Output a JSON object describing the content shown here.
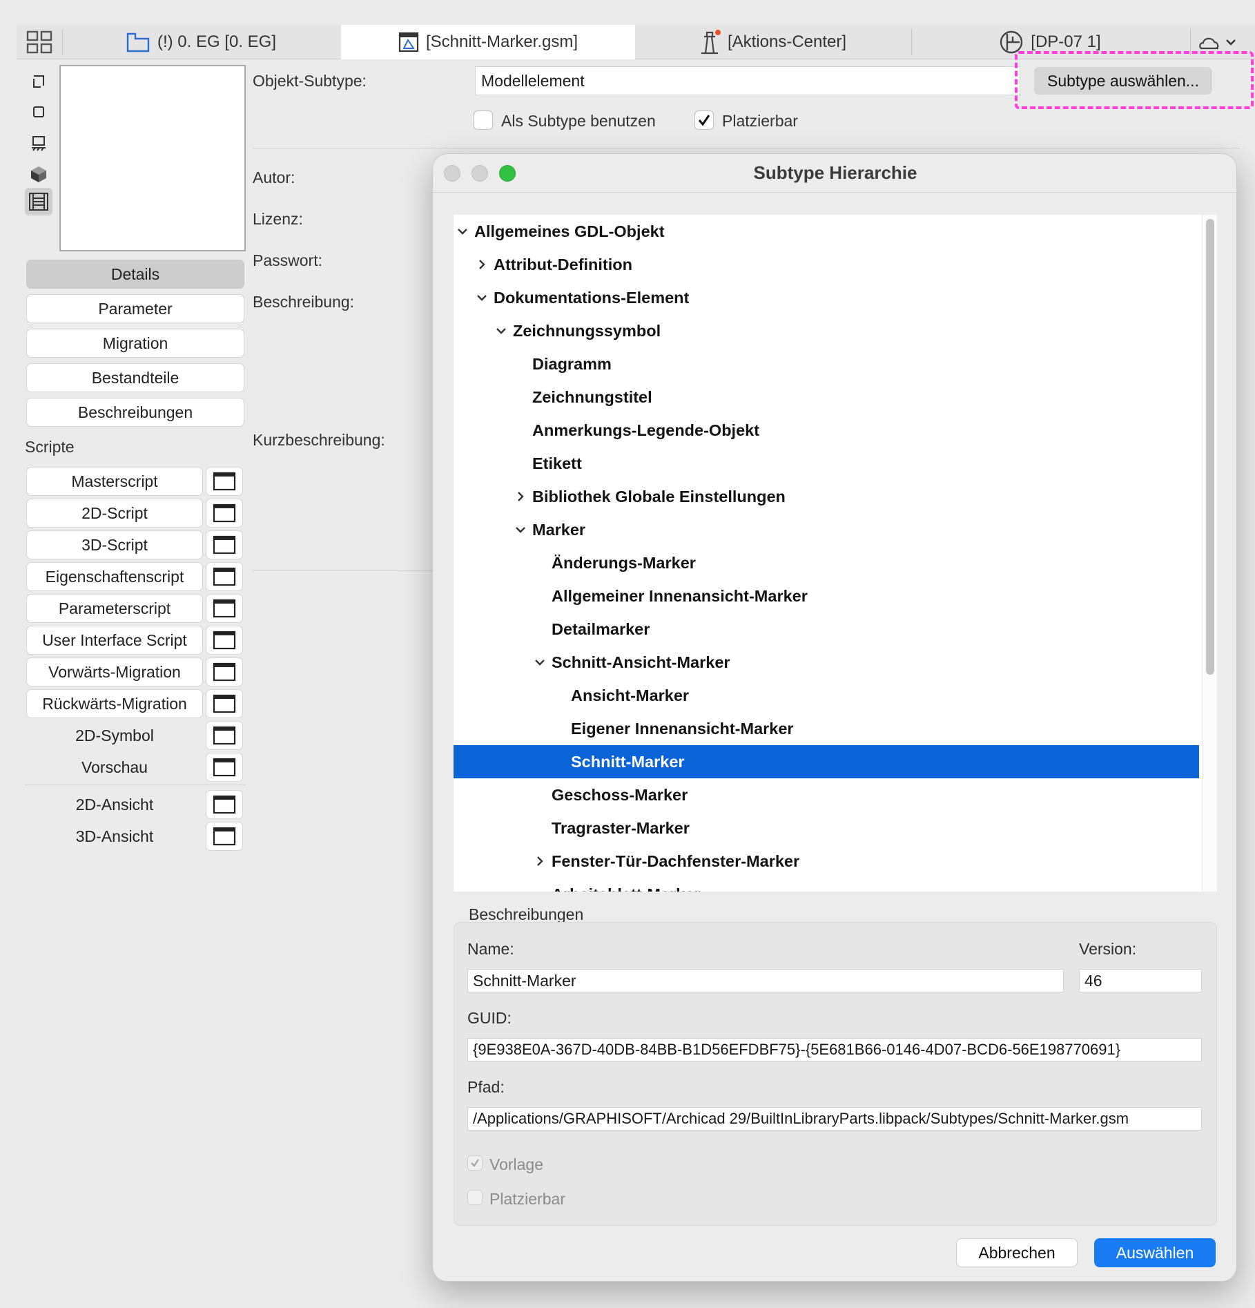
{
  "tabs": [
    {
      "label": "(!) 0. EG [0. EG]",
      "icon": "floor-plan-icon"
    },
    {
      "label": "[Schnitt-Marker.gsm]",
      "icon": "gsm-object-icon"
    },
    {
      "label": "[Aktions-Center]",
      "icon": "lighthouse-icon"
    },
    {
      "label": "[DP-07 1]",
      "icon": "detail-icon"
    }
  ],
  "sidebar": {
    "nav": [
      "Details",
      "Parameter",
      "Migration",
      "Bestandteile",
      "Beschreibungen"
    ],
    "scripts_label": "Scripte",
    "scripts": [
      "Masterscript",
      "2D-Script",
      "3D-Script",
      "Eigenschaftenscript",
      "Parameterscript",
      "User Interface Script",
      "Vorwärts-Migration",
      "Rückwärts-Migration"
    ],
    "symbols": [
      "2D-Symbol",
      "Vorschau"
    ],
    "views": [
      "2D-Ansicht",
      "3D-Ansicht"
    ]
  },
  "details": {
    "subtype_label": "Objekt-Subtype:",
    "subtype_value": "Modellelement",
    "select_button": "Subtype auswählen...",
    "use_as_subtype": "Als Subtype benutzen",
    "placeable": "Platzierbar",
    "author": "Autor:",
    "license": "Lizenz:",
    "password": "Passwort:",
    "description": "Beschreibung:",
    "short_description": "Kurzbeschreibung:"
  },
  "dialog": {
    "title": "Subtype Hierarchie",
    "tree": [
      {
        "label": "Allgemeines GDL-Objekt",
        "level": 0,
        "expander": "open"
      },
      {
        "label": "Attribut-Definition",
        "level": 1,
        "expander": "closed"
      },
      {
        "label": "Dokumentations-Element",
        "level": 1,
        "expander": "open"
      },
      {
        "label": "Zeichnungssymbol",
        "level": 2,
        "expander": "open"
      },
      {
        "label": "Diagramm",
        "level": 3,
        "expander": "none"
      },
      {
        "label": "Zeichnungstitel",
        "level": 3,
        "expander": "none"
      },
      {
        "label": "Anmerkungs-Legende-Objekt",
        "level": 3,
        "expander": "none"
      },
      {
        "label": "Etikett",
        "level": 3,
        "expander": "none"
      },
      {
        "label": "Bibliothek Globale Einstellungen",
        "level": 3,
        "expander": "closed"
      },
      {
        "label": "Marker",
        "level": 3,
        "expander": "open"
      },
      {
        "label": "Änderungs-Marker",
        "level": 4,
        "expander": "none"
      },
      {
        "label": "Allgemeiner Innenansicht-Marker",
        "level": 4,
        "expander": "none"
      },
      {
        "label": "Detailmarker",
        "level": 4,
        "expander": "none"
      },
      {
        "label": "Schnitt-Ansicht-Marker",
        "level": 4,
        "expander": "open"
      },
      {
        "label": "Ansicht-Marker",
        "level": 5,
        "expander": "none"
      },
      {
        "label": "Eigener Innenansicht-Marker",
        "level": 5,
        "expander": "none"
      },
      {
        "label": "Schnitt-Marker",
        "level": 5,
        "expander": "none",
        "selected": true
      },
      {
        "label": "Geschoss-Marker",
        "level": 4,
        "expander": "none"
      },
      {
        "label": "Tragraster-Marker",
        "level": 4,
        "expander": "none"
      },
      {
        "label": "Fenster-Tür-Dachfenster-Marker",
        "level": 4,
        "expander": "closed"
      },
      {
        "label": "Arbeitsblatt-Marker",
        "level": 4,
        "expander": "none"
      }
    ],
    "group_title": "Beschreibungen",
    "name_label": "Name:",
    "name_value": "Schnitt-Marker",
    "version_label": "Version:",
    "version_value": "46",
    "guid_label": "GUID:",
    "guid_value": "{9E938E0A-367D-40DB-84BB-B1D56EFDBF75}-{5E681B66-0146-4D07-BCD6-56E198770691}",
    "path_label": "Pfad:",
    "path_value": "/Applications/GRAPHISOFT/Archicad 29/BuiltInLibraryParts.libpack/Subtypes/Schnitt-Marker.gsm",
    "template_label": "Vorlage",
    "placeable_label": "Platzierbar",
    "cancel": "Abbrechen",
    "select": "Auswählen"
  },
  "colors": {
    "selection": "#0b63d8",
    "primary_button": "#1a7cf5",
    "highlight": "#ff3fd8"
  }
}
